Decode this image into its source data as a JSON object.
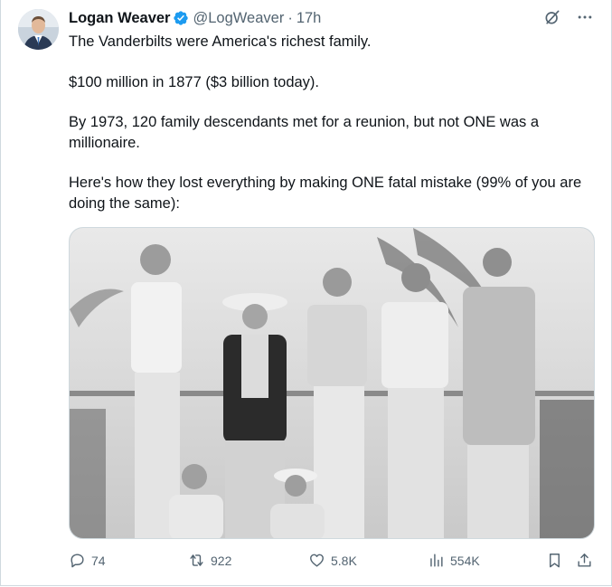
{
  "author": {
    "name": "Logan Weaver",
    "handle": "@LogWeaver",
    "separator": "·",
    "time": "17h",
    "verified": true,
    "badge_color": "#1d9bf0"
  },
  "tweet": {
    "paragraphs": [
      "The Vanderbilts were America's richest family.",
      "$100 million in 1877 ($3 billion today).",
      "By 1973, 120 family descendants met for a reunion, but not ONE was a millionaire.",
      "Here's how they lost everything by making ONE fatal mistake (99% of you are doing the same):"
    ]
  },
  "media": {
    "kind": "black-and-white group photo"
  },
  "actions": {
    "replies": "74",
    "reposts": "922",
    "likes": "5.8K",
    "views": "554K"
  },
  "icons": {
    "reply": "reply-icon",
    "repost": "repost-icon",
    "like": "like-icon",
    "views": "views-icon",
    "bookmark": "bookmark-icon",
    "share": "share-icon",
    "grok": "grok-icon",
    "more": "more-icon"
  },
  "colors": {
    "text": "#0f1419",
    "muted": "#536471",
    "border": "#cfd9de",
    "accent": "#1d9bf0"
  }
}
